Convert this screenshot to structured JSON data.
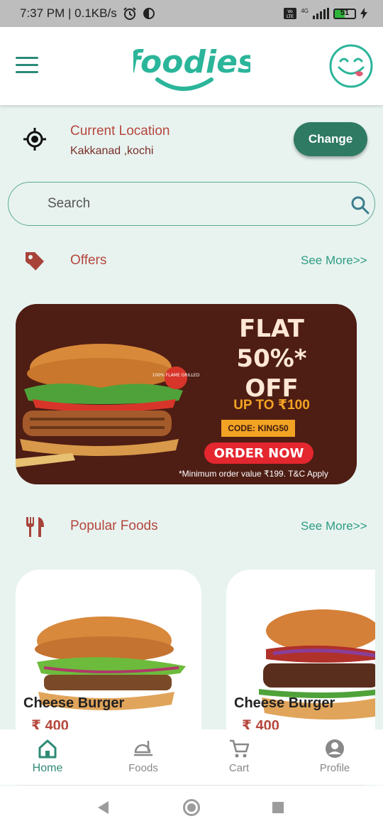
{
  "status": {
    "time_speed": "7:37 PM | 0.1KB/s",
    "network": "4G",
    "volte": "Vo LTE",
    "battery": "51",
    "battery_level": 0.51
  },
  "app": {
    "logo_text": "foodies",
    "accent": "#2f7a63",
    "text_accent": "#b5473d"
  },
  "location": {
    "title": "Current Location",
    "address": "Kakkanad ,kochi",
    "change_label": "Change"
  },
  "search": {
    "placeholder": "Search"
  },
  "offers": {
    "title": "Offers",
    "see_more": "See More>>"
  },
  "banner": {
    "line1": "FLAT",
    "line2": "50%*",
    "line3": "OFF",
    "upto": "UP TO ₹100",
    "code": "CODE: KING50",
    "cta": "ORDER NOW",
    "fine_print": "*Minimum order value ₹199. T&C Apply",
    "badge": "100% FLAME GRILLED"
  },
  "popular": {
    "title": "Popular Foods",
    "see_more": "See More>>"
  },
  "foods": [
    {
      "name": "Cheese Burger",
      "price": "₹ 400"
    },
    {
      "name": "Cheese Burger",
      "price": "₹ 400"
    }
  ],
  "nav": [
    {
      "label": "Home",
      "icon": "home-icon"
    },
    {
      "label": "Foods",
      "icon": "food-tray-icon"
    },
    {
      "label": "Cart",
      "icon": "cart-icon"
    },
    {
      "label": "Profile",
      "icon": "profile-icon"
    }
  ]
}
